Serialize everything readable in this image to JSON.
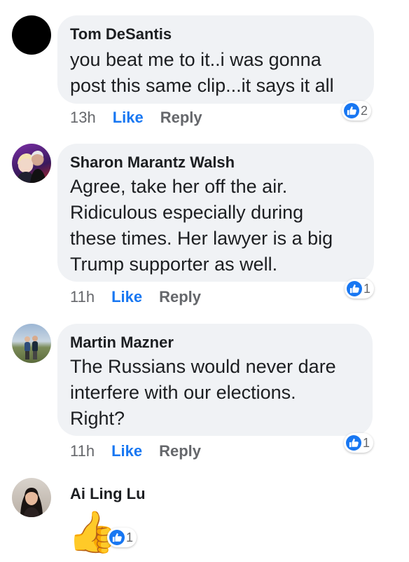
{
  "colors": {
    "like_blue": "#1877f2",
    "meta_gray": "#65676b",
    "bubble_bg": "#f0f2f5"
  },
  "comments": [
    {
      "author": "Tom DeSantis",
      "text": "you beat me to it..i was gonna\npost this same clip...it says it all",
      "time": "13h",
      "like_label": "Like",
      "reply_label": "Reply",
      "reaction_icon": "thumbs-up-icon",
      "reaction_count": "2",
      "avatar": "black-circle-avatar"
    },
    {
      "author": "Sharon Marantz Walsh",
      "text": "Agree, take her off the air.\nRidiculous especially during\nthese times.  Her lawyer is a big\nTrump supporter as well.",
      "time": "11h",
      "like_label": "Like",
      "reply_label": "Reply",
      "reaction_icon": "thumbs-up-icon",
      "reaction_count": "1",
      "avatar": "couple-photo-avatar"
    },
    {
      "author": "Martin Mazner",
      "text": "The Russians would never dare\ninterfere with our elections.\nRight?",
      "time": "11h",
      "like_label": "Like",
      "reply_label": "Reply",
      "reaction_icon": "thumbs-up-icon",
      "reaction_count": "1",
      "avatar": "outdoor-photo-avatar"
    },
    {
      "author": "Ai Ling Lu",
      "emoji": "👍",
      "reaction_icon": "thumbs-up-icon",
      "reaction_count": "1",
      "avatar": "portrait-photo-avatar"
    }
  ]
}
